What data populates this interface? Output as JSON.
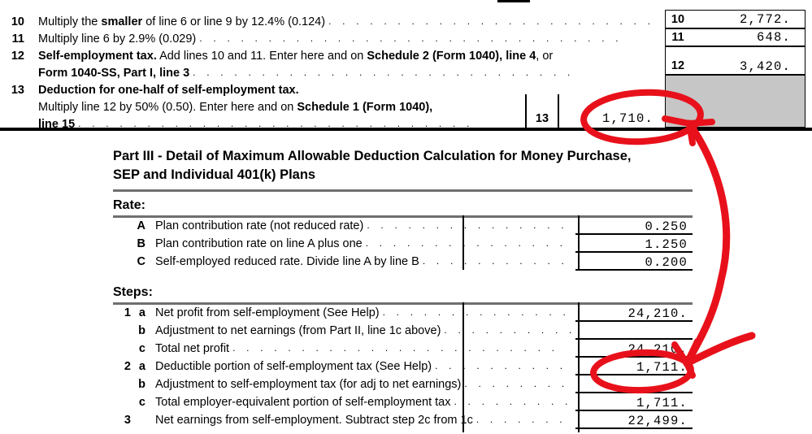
{
  "document": {
    "kind": "irs-schedule-se-worksheet",
    "top_section": {
      "lines": [
        {
          "number": "10",
          "text_runs": [
            {
              "t": "Multiply the ",
              "b": false
            },
            {
              "t": "smaller",
              "b": true
            },
            {
              "t": " of line 6 or line 9 by 12.4% (0.124)",
              "b": false
            }
          ],
          "plain": "Multiply the smaller of line 6 or line 9 by 12.4% (0.124)",
          "box_label": "10",
          "value": "2,772."
        },
        {
          "number": "11",
          "text_runs": [
            {
              "t": "Multiply line 6 by 2.9% (0.029)",
              "b": false
            }
          ],
          "plain": "Multiply line 6 by 2.9% (0.029)",
          "box_label": "11",
          "value": "648."
        },
        {
          "number": "12",
          "text_runs": [
            {
              "t": "Self-employment tax.",
              "b": true
            },
            {
              "t": " Add lines 10 and 11. Enter here and on ",
              "b": false
            },
            {
              "t": "Schedule 2 (Form 1040), line 4",
              "b": true
            },
            {
              "t": ", or",
              "b": false
            }
          ],
          "line2_runs": [
            {
              "t": "Form 1040-SS, Part I, line 3",
              "b": true
            }
          ],
          "plain": "Self-employment tax. Add lines 10 and 11. Enter here and on Schedule 2 (Form 1040), line 4, or Form 1040-SS, Part I, line 3",
          "box_label": "12",
          "value": "3,420."
        },
        {
          "number": "13",
          "heading_runs": [
            {
              "t": "Deduction for one-half of self-employment tax.",
              "b": true
            }
          ],
          "sub_line1_runs": [
            {
              "t": "Multiply line 12 by 50% (0.50). Enter here and on ",
              "b": false
            },
            {
              "t": "Schedule 1 (Form 1040),",
              "b": true
            }
          ],
          "sub_line2_runs": [
            {
              "t": "line 15",
              "b": true
            }
          ],
          "plain": "Deduction for one-half of self-employment tax. Multiply line 12 by 50% (0.50). Enter here and on Schedule 1 (Form 1040), line 15",
          "box_label": "13",
          "value": "1,710.",
          "right_cell_shaded": true
        }
      ]
    },
    "part3": {
      "title_line1": "Part III - Detail of Maximum Allowable Deduction Calculation for  Money Purchase,",
      "title_line2": "SEP and Individual 401(k) Plans",
      "rate": {
        "heading": "Rate:",
        "rows": [
          {
            "label": "A",
            "desc": "Plan contribution rate (not reduced rate)",
            "value": "0.250"
          },
          {
            "label": "B",
            "desc": "Plan contribution rate on line A plus one",
            "value": "1.250"
          },
          {
            "label": "C",
            "desc": "Self-employed reduced rate. Divide line A by line B",
            "value": "0.200"
          }
        ]
      },
      "steps": {
        "heading": "Steps:",
        "rows": [
          {
            "num": "1",
            "sub": "a",
            "desc": "Net profit from self-employment (See Help)",
            "value": "24,210."
          },
          {
            "num": "",
            "sub": "b",
            "desc": "Adjustment to net earnings (from Part II, line 1c above)",
            "value": ""
          },
          {
            "num": "",
            "sub": "c",
            "desc": "Total net profit",
            "value": "24,210."
          },
          {
            "num": "2",
            "sub": "a",
            "desc": "Deductible portion of self-employment tax (See Help)",
            "value": "1,711."
          },
          {
            "num": "",
            "sub": "b",
            "desc": "Adjustment to self-employment tax (for adj to net earnings)",
            "value": ""
          },
          {
            "num": "",
            "sub": "c",
            "desc": "Total employer-equivalent portion of self-employment tax",
            "value": "1,711."
          },
          {
            "num": "3",
            "sub": "",
            "desc": "Net earnings from self-employment. Subtract step 2c from 1c",
            "value": "22,499."
          }
        ]
      }
    },
    "annotation": {
      "color": "#e8111b",
      "shapes": [
        {
          "type": "ellipse",
          "target": "line-13-value",
          "label": "1,710."
        },
        {
          "type": "ellipse",
          "target": "step-2a-value",
          "label": "1,711."
        },
        {
          "type": "arrow",
          "from": "line-13-value",
          "to": "step-2a-value"
        },
        {
          "type": "arrow",
          "from": "right-margin",
          "to": "step-2a-value"
        }
      ]
    }
  }
}
